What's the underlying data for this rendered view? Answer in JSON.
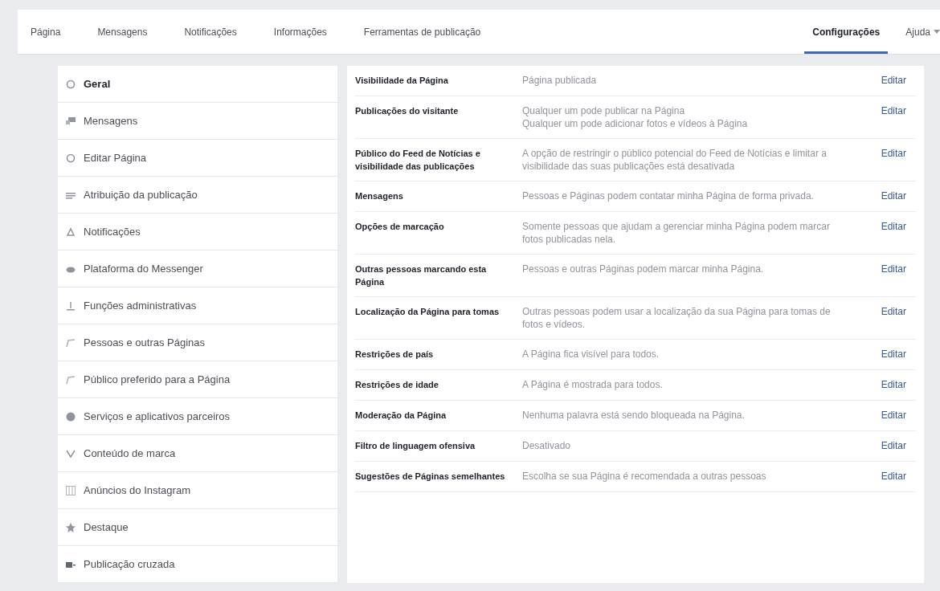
{
  "tabs": [
    {
      "label": "Página",
      "selected": false
    },
    {
      "label": "Mensagens",
      "selected": false
    },
    {
      "label": "Notificações",
      "selected": false
    },
    {
      "label": "Informações",
      "selected": false
    },
    {
      "label": "Ferramentas de publicação",
      "selected": false
    },
    {
      "label": "Configurações",
      "selected": true
    },
    {
      "label": "Ajuda",
      "selected": false,
      "dropdown": true
    }
  ],
  "sidebar": {
    "items": [
      {
        "label": "Geral",
        "selected": true
      },
      {
        "label": "Mensagens",
        "selected": false
      },
      {
        "label": "Editar Página",
        "selected": false
      },
      {
        "label": "Atribuição da publicação",
        "selected": false
      },
      {
        "label": "Notificações",
        "selected": false
      },
      {
        "label": "Plataforma do Messenger",
        "selected": false
      },
      {
        "label": "Funções administrativas",
        "selected": false
      },
      {
        "label": "Pessoas e outras Páginas",
        "selected": false
      },
      {
        "label": "Público preferido para a Página",
        "selected": false
      },
      {
        "label": "Serviços e aplicativos parceiros",
        "selected": false
      },
      {
        "label": "Conteúdo de marca",
        "selected": false
      },
      {
        "label": "Anúncios do Instagram",
        "selected": false
      },
      {
        "label": "Destaque",
        "selected": false
      },
      {
        "label": "Publicação cruzada",
        "selected": false
      }
    ]
  },
  "settings": [
    {
      "name": "Visibilidade da Página",
      "description": [
        "Página publicada"
      ],
      "action": "Editar"
    },
    {
      "name": "Publicações do visitante",
      "description": [
        "Qualquer um pode publicar na Página",
        "Qualquer um pode adicionar fotos e vídeos à Página"
      ],
      "action": "Editar"
    },
    {
      "name": "Público do Feed de Notícias e visibilidade das publicações",
      "description": [
        "A opção de restringir o público potencial do Feed de Notícias e limitar a visibilidade das suas publicações está desativada"
      ],
      "action": "Editar"
    },
    {
      "name": "Mensagens",
      "description": [
        "Pessoas e Páginas podem contatar minha Página de forma privada."
      ],
      "action": "Editar"
    },
    {
      "name": "Opções de marcação",
      "description": [
        "Somente pessoas que ajudam a gerenciar minha Página podem marcar fotos publicadas nela."
      ],
      "action": "Editar"
    },
    {
      "name": "Outras pessoas marcando esta Página",
      "description": [
        "Pessoas e outras Páginas podem marcar minha Página."
      ],
      "action": "Editar"
    },
    {
      "name": "Localização da Página para tomas",
      "description": [
        "Outras pessoas podem usar a localização da sua Página para tomas de fotos e vídeos."
      ],
      "action": "Editar"
    },
    {
      "name": "Restrições de país",
      "description": [
        "A Página fica visível para todos."
      ],
      "action": "Editar"
    },
    {
      "name": "Restrições de idade",
      "description": [
        "A Página é mostrada para todos."
      ],
      "action": "Editar"
    },
    {
      "name": "Moderação da Página",
      "description": [
        "Nenhuma palavra está sendo bloqueada na Página."
      ],
      "action": "Editar"
    },
    {
      "name": "Filtro de linguagem ofensiva",
      "description": [
        "Desativado"
      ],
      "action": "Editar"
    },
    {
      "name": "Sugestões de Páginas semelhantes",
      "description": [
        "Escolha se sua Página é recomendada a outras pessoas"
      ],
      "action": "Editar"
    }
  ]
}
